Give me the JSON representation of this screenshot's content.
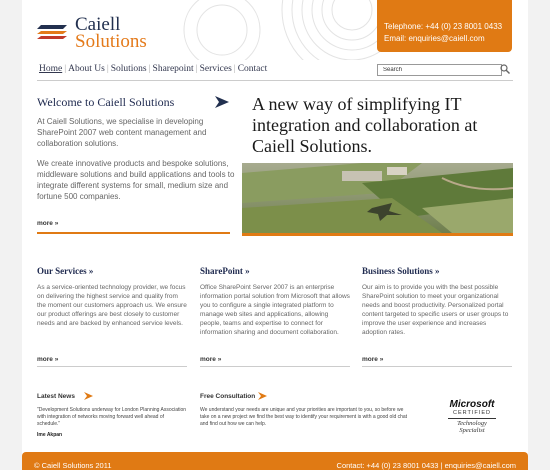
{
  "logo": {
    "line1": "Caiell",
    "line2": "Solutions"
  },
  "contact": {
    "phone": "Telephone: +44 (0) 23 8001 0433",
    "email": "Email: enquiries@caiell.com"
  },
  "nav": {
    "items": [
      "Home",
      "About Us",
      "Solutions",
      "Sharepoint",
      "Services",
      "Contact"
    ]
  },
  "search": {
    "value": "Search"
  },
  "welcome": {
    "title": "Welcome to Caiell Solutions",
    "p1": "At Caiell Solutions, we specialise in developing SharePoint 2007 web content management and collaboration solutions.",
    "p2": "We create innovative products and bespoke solutions, middleware solutions and build applications and tools to integrate different systems for small, medium size and fortune 500 companies.",
    "more": "more »"
  },
  "banner": {
    "tagline": "A new way of simplifying IT integration and collaboration at Caiell Solutions."
  },
  "columns": [
    {
      "title": "Our Services »",
      "text": "As a service-oriented technology provider, we focus on delivering the highest service and quality from the moment our customers approach us. We ensure our product offerings are best closely to customer needs and are backed by enhanced service levels.",
      "more": "more »"
    },
    {
      "title": "SharePoint »",
      "text": "Office SharePoint Server 2007 is an enterprise information portal solution from Microsoft that allows you to configure a single integrated platform to manage web sites and applications, allowing people, teams and expertise to connect for information sharing and document collaboration.",
      "more": "more »"
    },
    {
      "title": "Business Solutions »",
      "text": "Our aim is to provide you with the best possible SharePoint solution to meet your organizational needs and boost productivity. Personalized portal content targeted to specific users or user groups to improve the user experience and increases adoption rates.",
      "more": "more »"
    }
  ],
  "latest_news": {
    "title": "Latest News",
    "text": "\"Development Solutions underway for London Planning Association with integration of networks moving forward well ahead of schedule.\"",
    "author": "Ime Akpan"
  },
  "consultation": {
    "title": "Free Consultation",
    "text": "We understand your needs are unique and your priorities are important to you, so before we take on a new project we find the best way to identify your requirement is with a good old chat and find out how we can help."
  },
  "microsoft": {
    "line1": "Microsoft",
    "line2": "CERTIFIED",
    "line3": "Technology",
    "line4": "Specialist"
  },
  "footer": {
    "copyright": "© Caiell Solutions 2011",
    "contact": "Contact: +44 (0) 23 8001 0433 | enquiries@caiell.com"
  },
  "colors": {
    "accent": "#e07a14",
    "navy": "#1f2a4f"
  }
}
